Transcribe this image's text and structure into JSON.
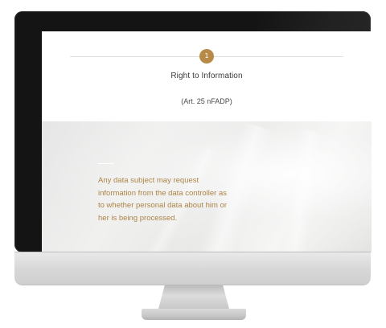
{
  "page": {
    "step_number": "1",
    "section_title": "Right to Information",
    "section_subtitle": "(Art. 25 nFADP)",
    "hero_text": "Any data subject may request information from the data controller as to whether personal data about him or her is being processed."
  },
  "colors": {
    "accent_gold": "#b78a47",
    "hero_text": "#ad8446",
    "bezel": "#141414",
    "chin": "#d8d8d8"
  },
  "icons": {
    "step_badge": "circle-badge"
  }
}
